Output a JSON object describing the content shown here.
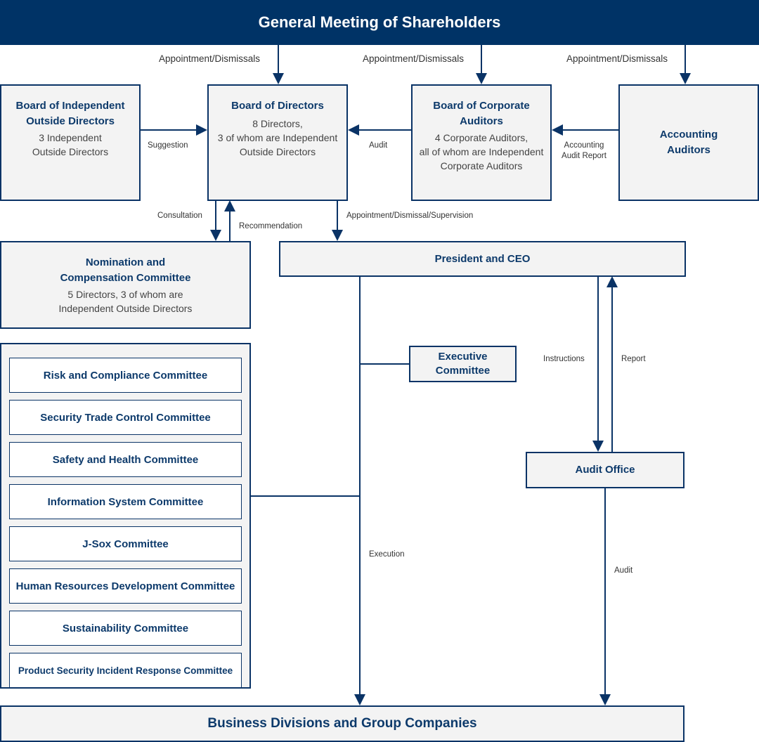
{
  "header": {
    "title": "General Meeting of Shareholders"
  },
  "colors": {
    "primary": "#003366",
    "box_fill": "#f3f3f3",
    "text": "#0d3a6b"
  },
  "boards": {
    "independent_outside": {
      "title_line1": "Board of Independent",
      "title_line2": "Outside Directors",
      "desc_line1": "3 Independent",
      "desc_line2": "Outside Directors"
    },
    "directors": {
      "title": "Board of Directors",
      "desc_line1": "8 Directors,",
      "desc_line2": "3 of whom are Independent",
      "desc_line3": "Outside Directors"
    },
    "corporate_auditors": {
      "title_line1": "Board of Corporate",
      "title_line2": "Auditors",
      "desc_line1": "4 Corporate Auditors,",
      "desc_line2": "all of whom are Independent",
      "desc_line3": "Corporate Auditors"
    },
    "accounting_auditors": {
      "title_line1": "Accounting",
      "title_line2": "Auditors"
    }
  },
  "nomination": {
    "title_line1": "Nomination and",
    "title_line2": "Compensation Committee",
    "desc_line1": "5 Directors, 3 of whom are",
    "desc_line2": "Independent Outside Directors"
  },
  "president": {
    "title": "President and CEO"
  },
  "executive": {
    "title_line1": "Executive",
    "title_line2": "Committee"
  },
  "audit_office": {
    "title": "Audit Office"
  },
  "business": {
    "title": "Business Divisions and Group Companies"
  },
  "committees": [
    "Risk and Compliance Committee",
    "Security Trade Control Committee",
    "Safety and Health Committee",
    "Information System Committee",
    "J-Sox Committee",
    "Human Resources Development Committee",
    "Sustainability Committee",
    "Product Security Incident Response Committee"
  ],
  "labels": {
    "appointment_1": "Appointment/Dismissals",
    "appointment_2": "Appointment/Dismissals",
    "appointment_3": "Appointment/Dismissals",
    "suggestion": "Suggestion",
    "audit_top": "Audit",
    "accounting_report_line1": "Accounting",
    "accounting_report_line2": "Audit Report",
    "consultation": "Consultation",
    "recommendation": "Recommendation",
    "appointment_supervision": "Appointment/Dismissal/Supervision",
    "instructions": "Instructions",
    "report": "Report",
    "execution": "Execution",
    "audit_bottom": "Audit"
  }
}
